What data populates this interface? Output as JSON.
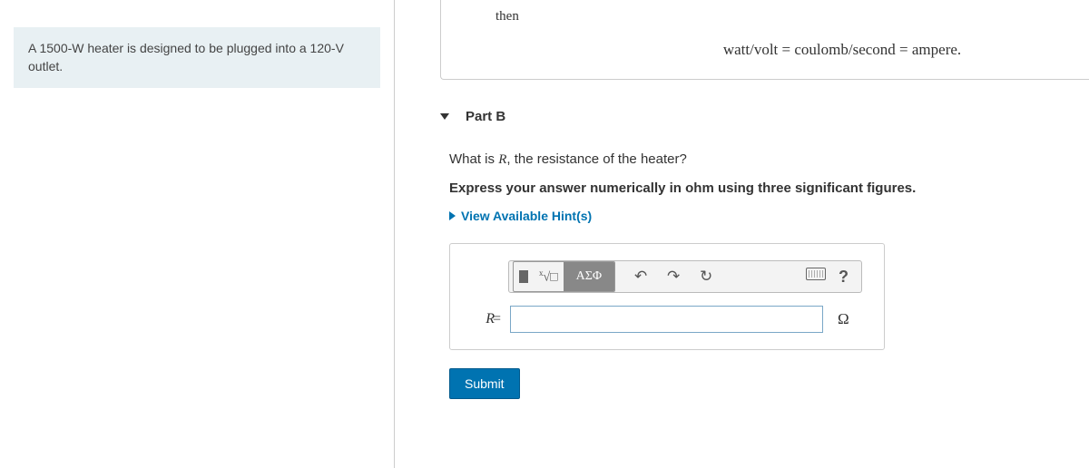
{
  "problem": {
    "statement": "A 1500-W heater is designed to be plugged into a 120-V outlet."
  },
  "topHint": {
    "thenWord": "then",
    "equation": "watt/volt = coulomb/second = ampere."
  },
  "part": {
    "label": "Part B",
    "questionPrefix": "What is ",
    "questionVar": "R",
    "questionSuffix": ", the resistance of the heater?",
    "instruction": "Express your answer numerically in ohm using three significant figures.",
    "hintsLabel": "View Available Hint(s)"
  },
  "toolbar": {
    "greek": "ΑΣΦ",
    "help": "?"
  },
  "answer": {
    "varLabel": "R",
    "eq": "=",
    "value": "",
    "unit": "Ω"
  },
  "actions": {
    "submit": "Submit"
  }
}
